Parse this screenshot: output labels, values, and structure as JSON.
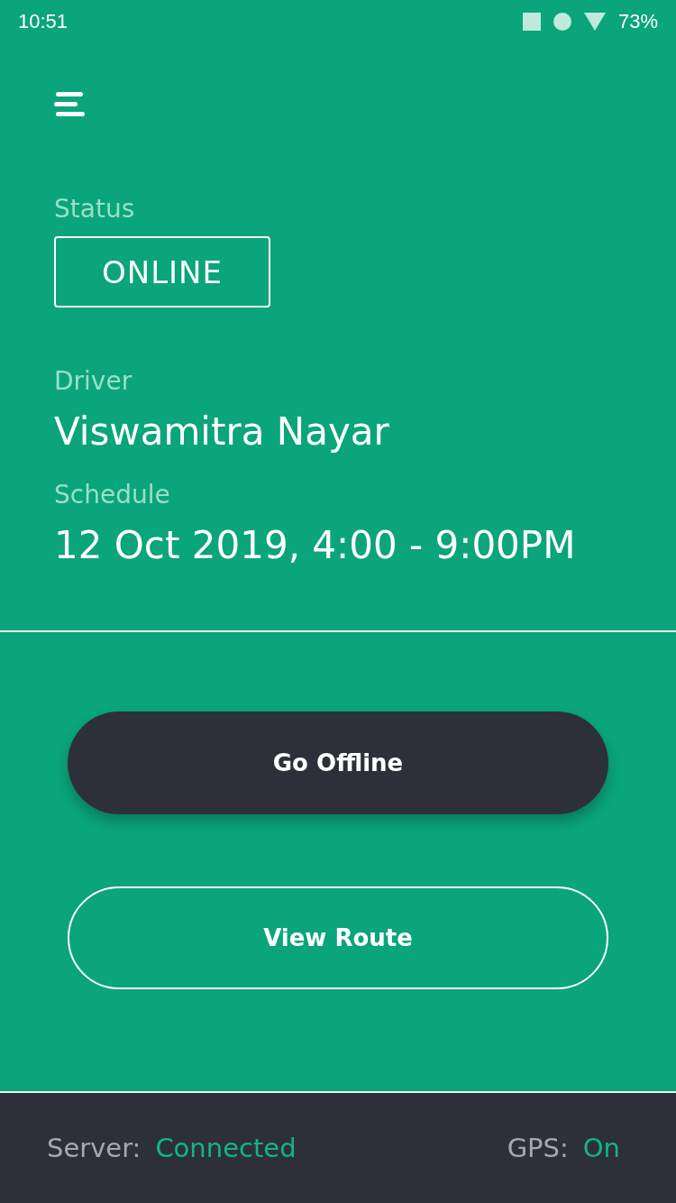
{
  "status_bar": {
    "time": "10:51",
    "battery": "73%"
  },
  "status": {
    "label": "Status",
    "value": "ONLINE"
  },
  "driver": {
    "label": "Driver",
    "name": "Viswamitra Nayar"
  },
  "schedule": {
    "label": "Schedule",
    "value": "12 Oct 2019, 4:00 - 9:00PM"
  },
  "buttons": [
    {
      "label": "Go Offline",
      "kind": "filled"
    },
    {
      "label": "View Route",
      "kind": "outlined"
    }
  ],
  "footer": {
    "server_label": "Server:",
    "server_value": "Connected",
    "gps_label": "GPS:",
    "gps_value": "On"
  }
}
